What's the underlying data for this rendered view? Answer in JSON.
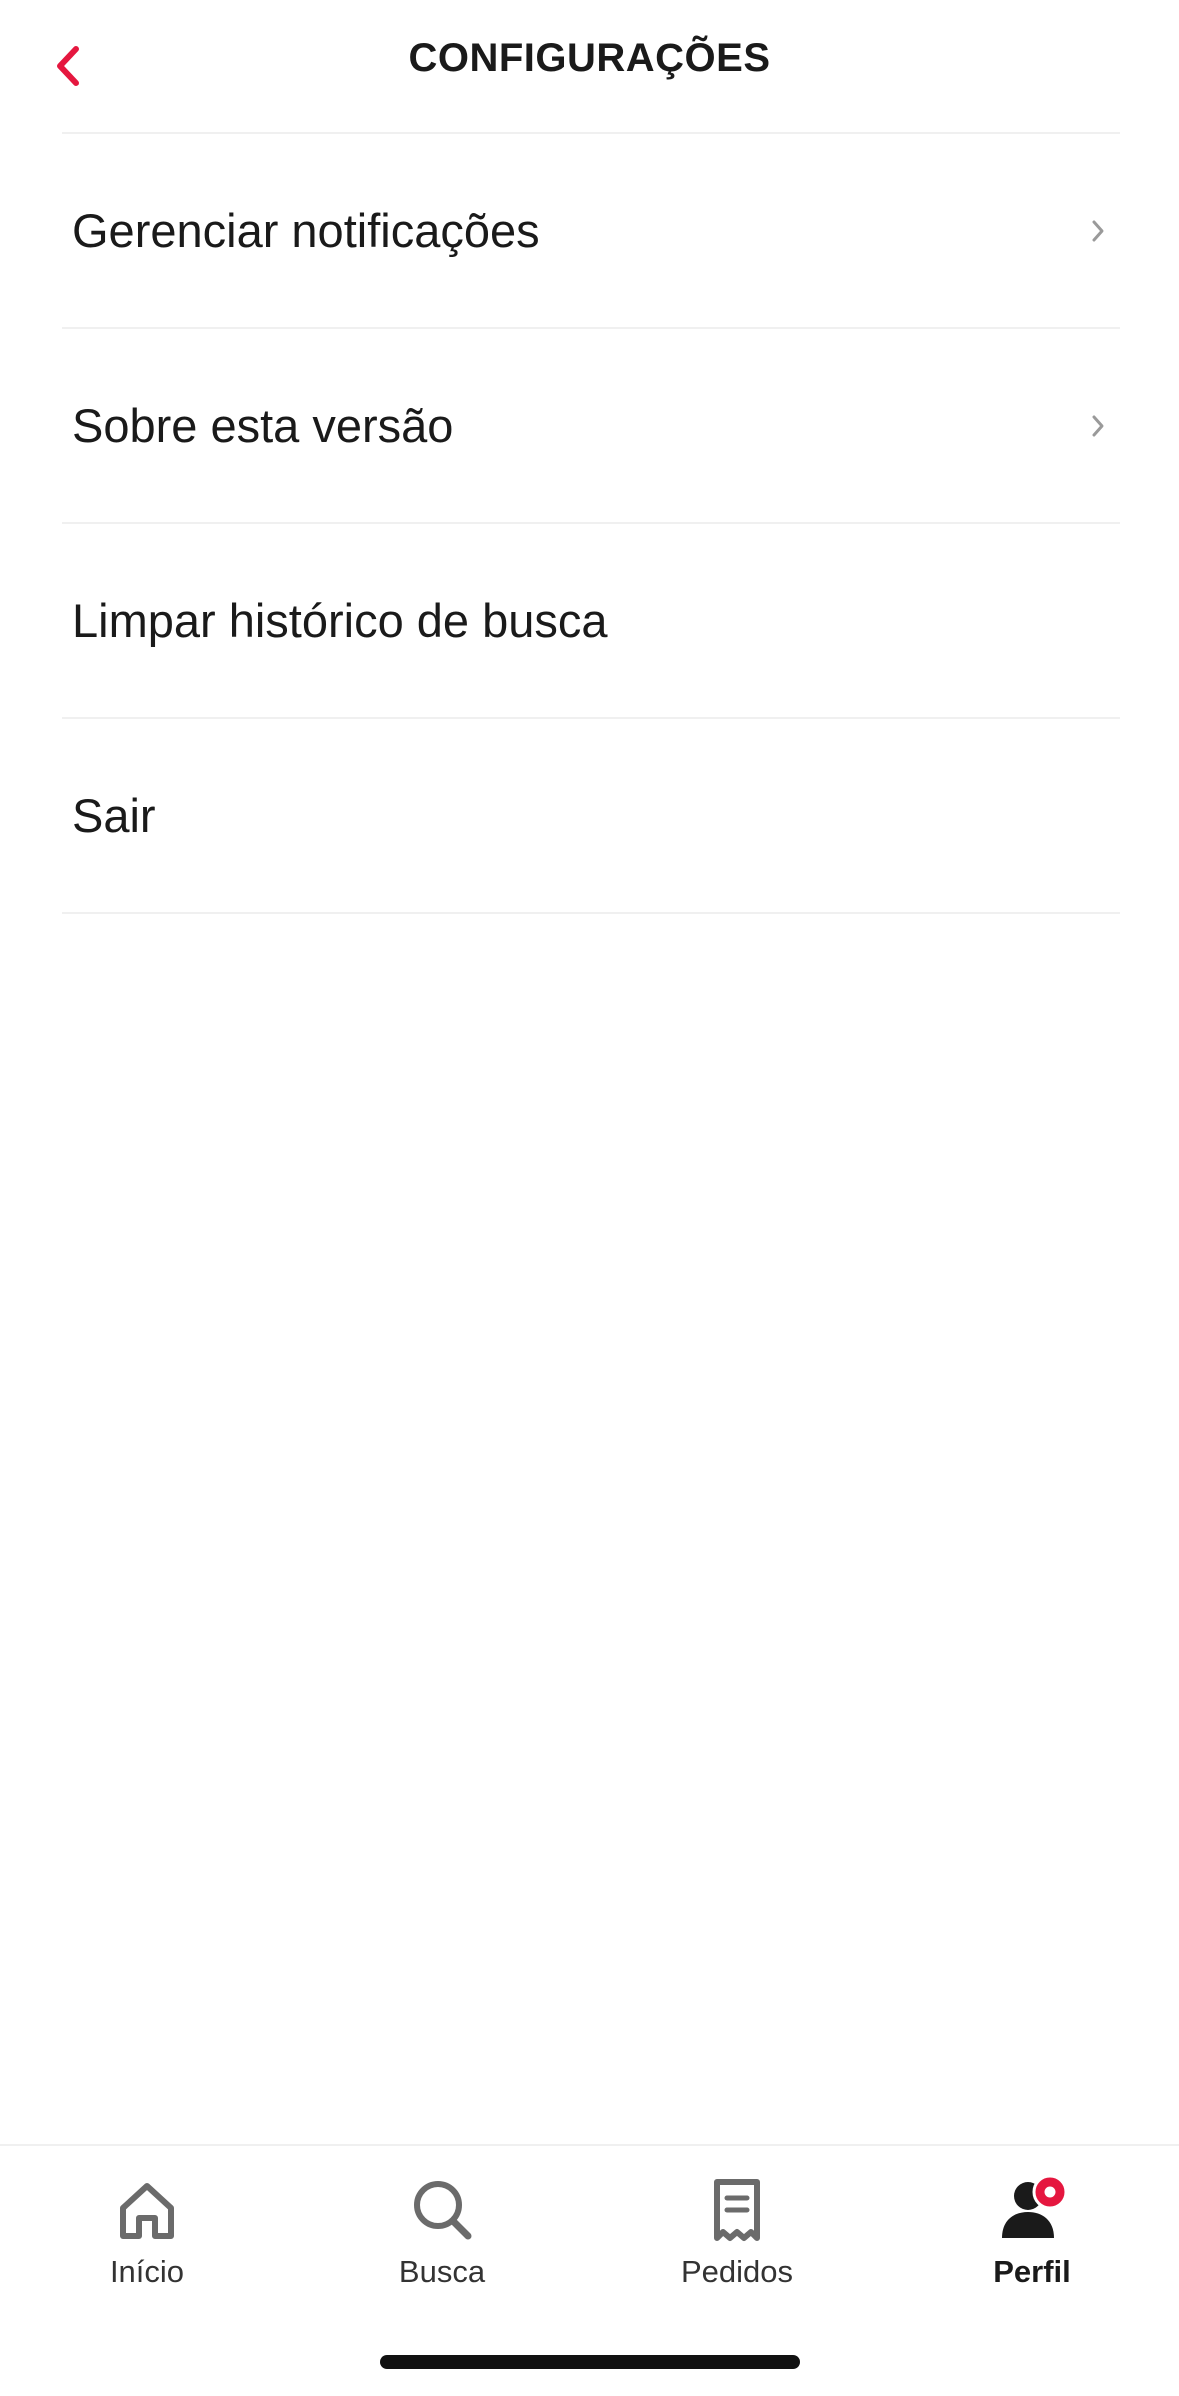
{
  "header": {
    "title": "CONFIGURAÇÕES",
    "back_icon": "chevron-left-icon",
    "accent_color": "#E5173F"
  },
  "menu": {
    "items": [
      {
        "label": "Gerenciar notificações",
        "has_chevron": true
      },
      {
        "label": "Sobre esta versão",
        "has_chevron": true
      },
      {
        "label": "Limpar histórico de busca",
        "has_chevron": false
      },
      {
        "label": "Sair",
        "has_chevron": false
      }
    ]
  },
  "tabbar": {
    "tabs": [
      {
        "label": "Início",
        "icon": "home-icon",
        "active": false
      },
      {
        "label": "Busca",
        "icon": "search-icon",
        "active": false
      },
      {
        "label": "Pedidos",
        "icon": "receipt-icon",
        "active": false
      },
      {
        "label": "Perfil",
        "icon": "profile-icon",
        "active": true,
        "badge_color": "#E5173F"
      }
    ]
  }
}
